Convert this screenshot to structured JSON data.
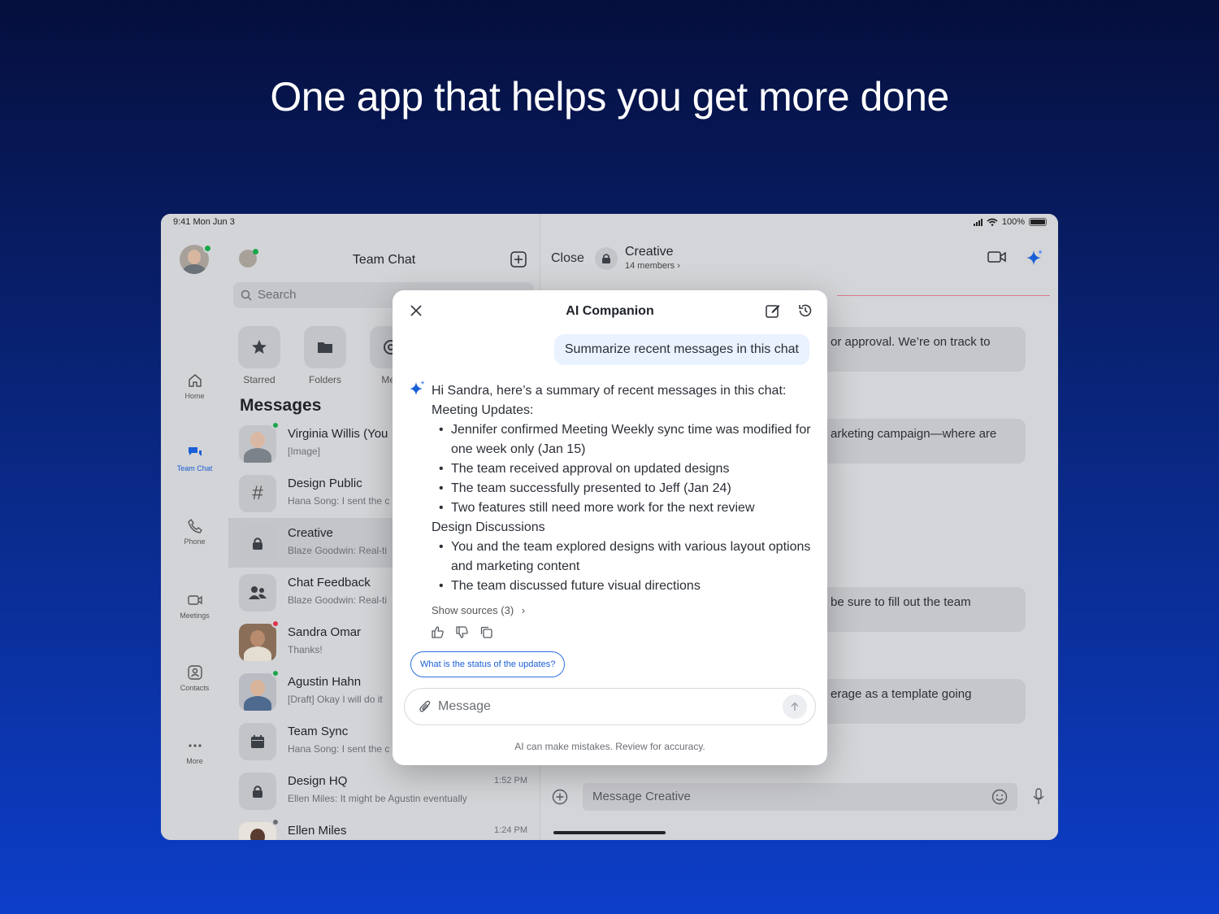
{
  "hero": {
    "headline": "One app that helps you get more done"
  },
  "status_bar": {
    "time": "9:41  Mon Jun 3",
    "battery": "100%"
  },
  "rail": {
    "items": [
      {
        "label": "Home",
        "icon": "home-icon"
      },
      {
        "label": "Team Chat",
        "icon": "chat-icon",
        "active": true
      },
      {
        "label": "Phone",
        "icon": "phone-icon"
      },
      {
        "label": "Meetings",
        "icon": "video-icon"
      },
      {
        "label": "Contacts",
        "icon": "contacts-icon"
      },
      {
        "label": "More",
        "icon": "more-icon"
      }
    ]
  },
  "list": {
    "title": "Team Chat",
    "search_placeholder": "Search",
    "quick": [
      {
        "label": "Starred",
        "icon": "star-icon"
      },
      {
        "label": "Folders",
        "icon": "folder-icon"
      },
      {
        "label": "Men",
        "icon": "mention-icon"
      }
    ],
    "section_title": "Messages",
    "rows": [
      {
        "name": "Virginia Willis (You",
        "sub": "[Image]",
        "time": ""
      },
      {
        "name": "Design Public",
        "sub": "Hana Song: I sent the c",
        "time": ""
      },
      {
        "name": "Creative",
        "sub": "Blaze Goodwin: Real-ti",
        "time": ""
      },
      {
        "name": "Chat Feedback",
        "sub": "Blaze Goodwin: Real-ti",
        "time": ""
      },
      {
        "name": "Sandra Omar",
        "sub": "Thanks!",
        "time": ""
      },
      {
        "name": "Agustin Hahn",
        "sub": "[Draft] Okay I will do it",
        "time": ""
      },
      {
        "name": "Team Sync",
        "sub": "Hana Song: I sent the c",
        "time": ""
      },
      {
        "name": "Design HQ",
        "sub": "Ellen Miles: It might be Agustin eventually",
        "time": "1:52 PM"
      },
      {
        "name": "Ellen Miles",
        "sub": "",
        "time": "1:24 PM"
      }
    ]
  },
  "chat": {
    "close_label": "Close",
    "channel_name": "Creative",
    "members": "14 members ›",
    "bubbles": [
      "or approval. We’re on track to",
      "arketing campaign—where are",
      "be sure to fill out the team",
      "erage as a template going"
    ],
    "composer_placeholder": "Message Creative"
  },
  "ai_companion": {
    "title": "AI Companion",
    "user_prompt": "Summarize recent messages in this chat",
    "intro": "Hi Sandra, here’s a summary of recent messages in this chat:",
    "sections": [
      {
        "heading": "Meeting Updates:",
        "bullets": [
          "Jennifer confirmed Meeting Weekly sync time was modified for one week only (Jan 15)",
          "The team received approval on updated designs",
          "The team successfully presented to Jeff (Jan 24)",
          "Two features still need more work for the next review"
        ]
      },
      {
        "heading": "Design Discussions",
        "bullets": [
          "You and the team explored designs with various layout options and marketing content",
          "The team discussed future visual directions"
        ]
      }
    ],
    "show_sources": "Show sources (3)",
    "suggestion_chip": "What is the status of the updates?",
    "input_placeholder": "Message",
    "disclaimer": "AI can make mistakes. Review for accuracy."
  },
  "colors": {
    "accent": "#1a5fd6",
    "online": "#19a74a",
    "busy": "#e0334a"
  }
}
